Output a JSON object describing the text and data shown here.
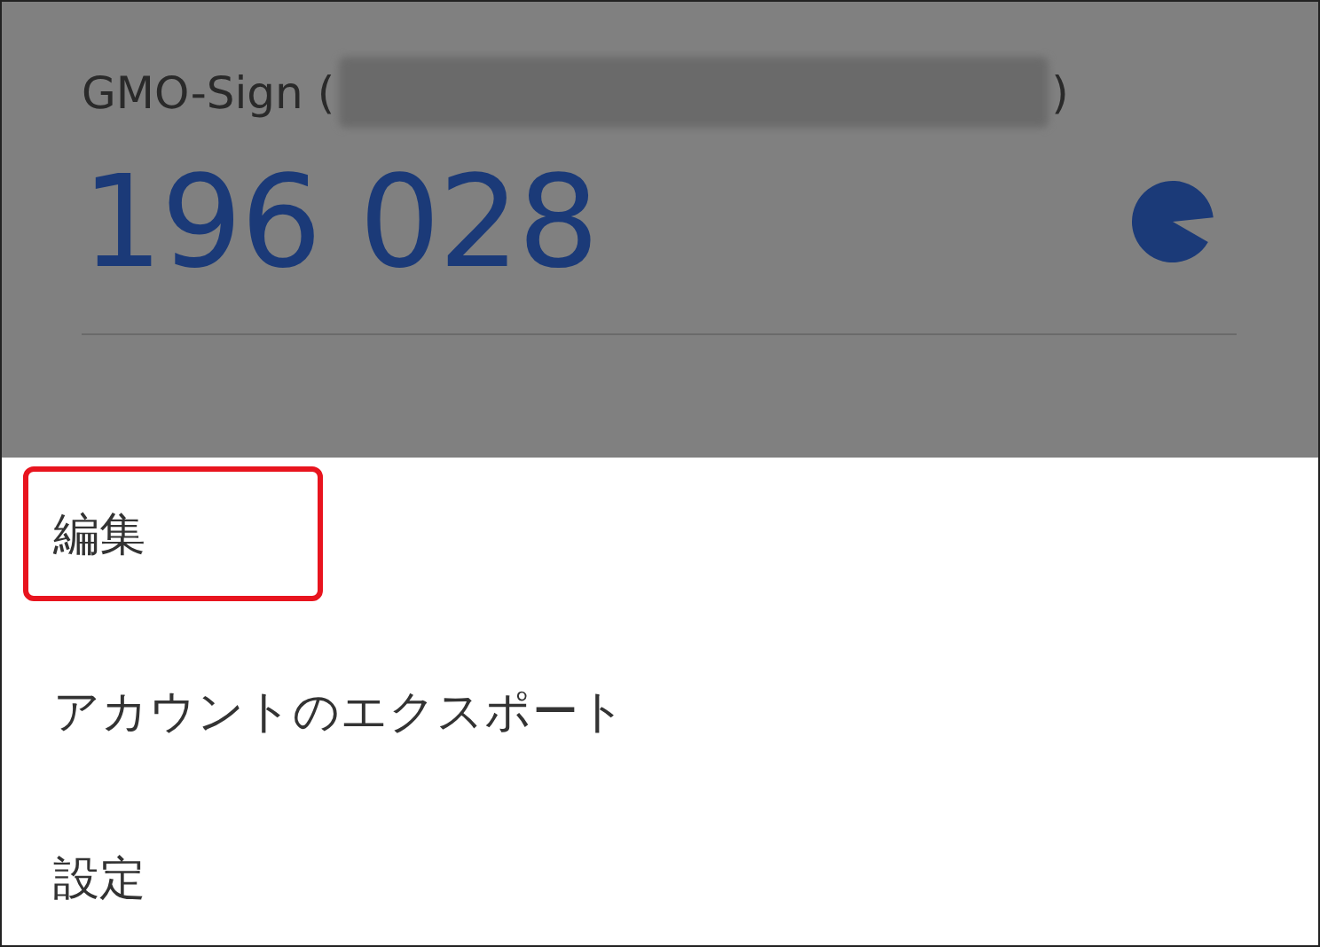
{
  "account": {
    "issuer": "GMO-Sign (",
    "account_redacted": true,
    "closing": ")",
    "code": "196 028",
    "timer": {
      "level": 0.9
    }
  },
  "menu": {
    "items": [
      {
        "label": "編集",
        "highlighted": true
      },
      {
        "label": "アカウントのエクスポート",
        "highlighted": false
      },
      {
        "label": "設定",
        "highlighted": false
      }
    ]
  }
}
